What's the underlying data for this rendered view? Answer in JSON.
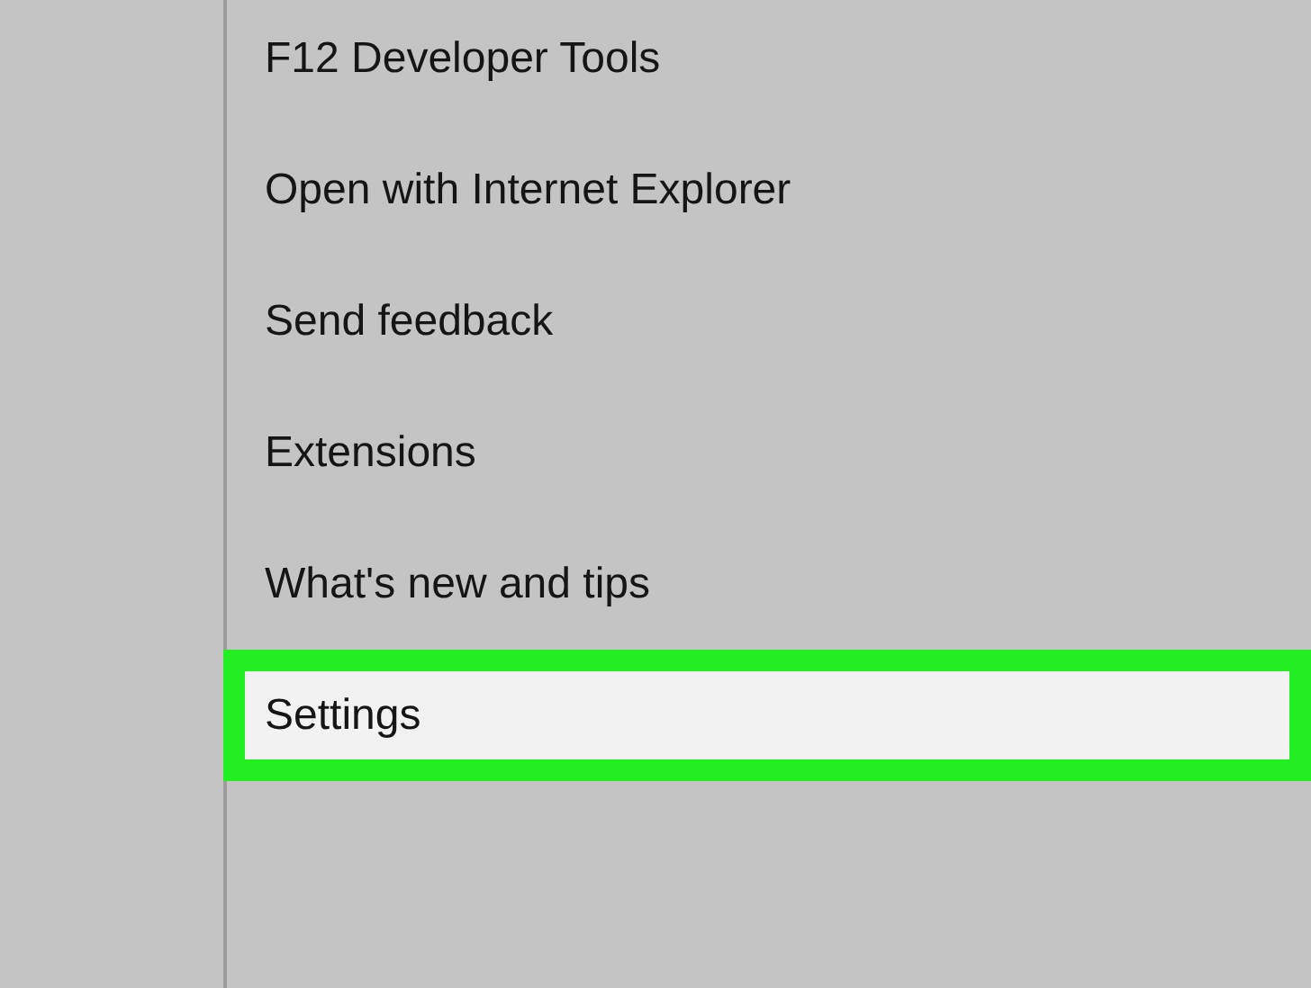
{
  "menu": {
    "items": [
      {
        "label": "F12 Developer Tools",
        "selected": false
      },
      {
        "label": "Open with Internet Explorer",
        "selected": false
      },
      {
        "label": "Send feedback",
        "selected": false
      },
      {
        "label": "Extensions",
        "selected": false
      },
      {
        "label": "What's new and tips",
        "selected": false
      },
      {
        "label": "Settings",
        "selected": true
      }
    ]
  }
}
